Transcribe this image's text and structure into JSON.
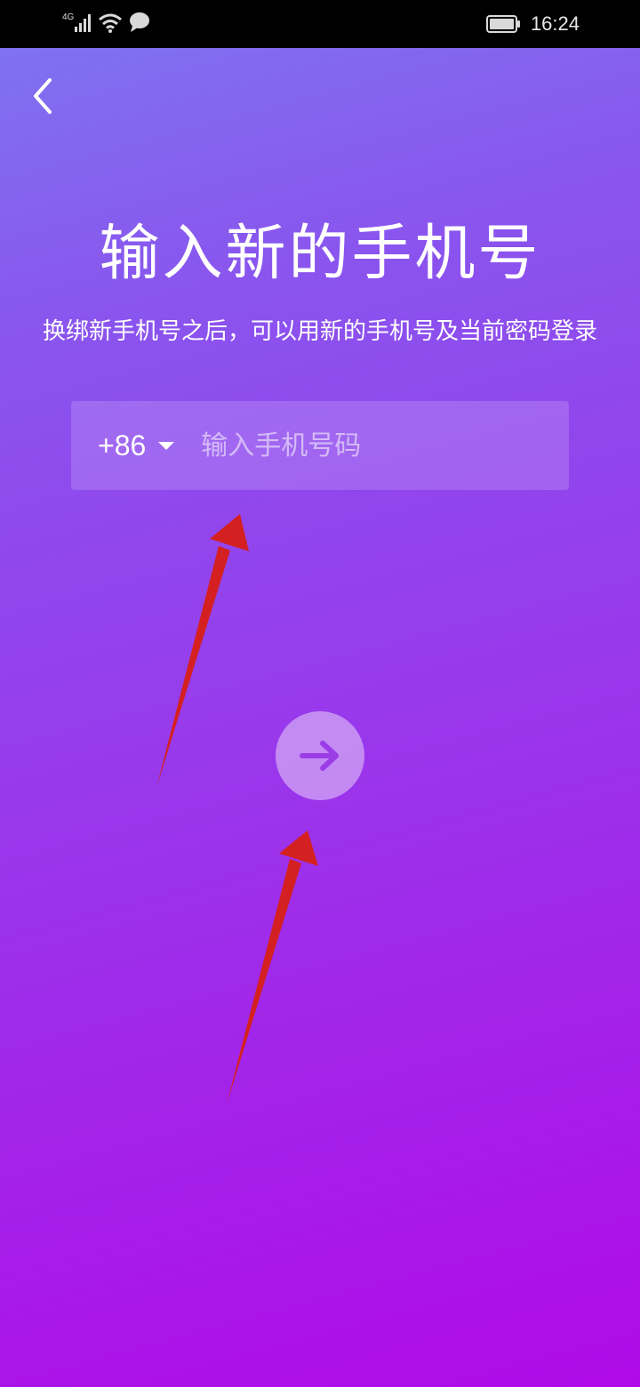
{
  "status_bar": {
    "network": "4G",
    "time": "16:24"
  },
  "page": {
    "title": "输入新的手机号",
    "subtitle": "换绑新手机号之后，可以用新的手机号及当前密码登录"
  },
  "phone_field": {
    "country_code": "+86",
    "placeholder": "输入手机号码",
    "value": ""
  },
  "colors": {
    "gradient_top": "#7f72f0",
    "gradient_bottom": "#b00ae8",
    "annotation_arrow": "#d42020",
    "next_arrow": "#9b3de6"
  },
  "icons": {
    "back": "chevron-left-icon",
    "next": "arrow-right-icon",
    "dropdown": "caret-down-icon"
  }
}
